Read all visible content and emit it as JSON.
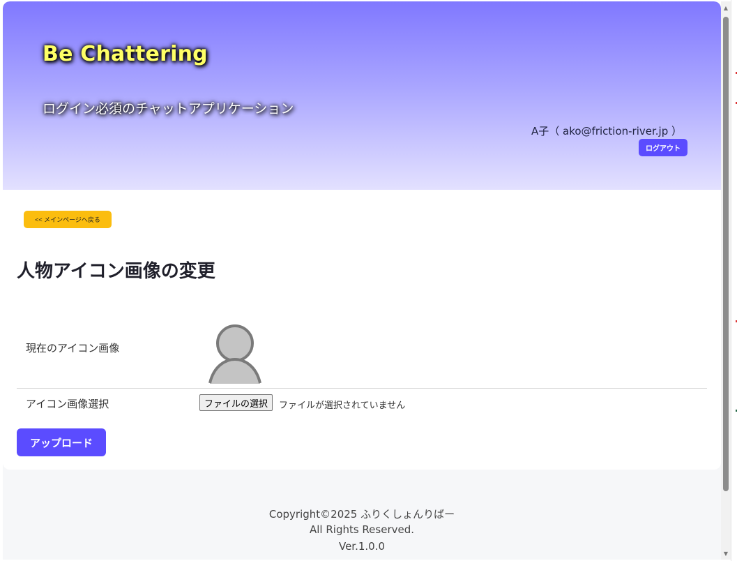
{
  "header": {
    "title": "Be Chattering",
    "subtitle": "ログイン必須のチャットアプリケーション",
    "user_info": "A子（ ako@friction-river.jp ）",
    "logout_label": "ログアウト"
  },
  "main": {
    "back_label": "<< メインページへ戻る",
    "page_title": "人物アイコン画像の変更",
    "current_icon_label": "現在のアイコン画像",
    "select_icon_label": "アイコン画像選択",
    "file_button_label": "ファイルの選択",
    "file_status": "ファイルが選択されていません",
    "upload_label": "アップロード"
  },
  "footer": {
    "copyright": "Copyright©2025 ふりくしょんりばー",
    "rights": "All Rights Reserved.",
    "version": "Ver.1.0.0"
  },
  "colors": {
    "accent": "#5b4cff",
    "back_button": "#fbbd0f",
    "title_text": "#ffff66",
    "header_top": "#8078ff"
  },
  "icons": {
    "avatar": "person-silhouette-icon",
    "scroll_up": "triangle-up-icon",
    "scroll_down": "triangle-down-icon"
  }
}
